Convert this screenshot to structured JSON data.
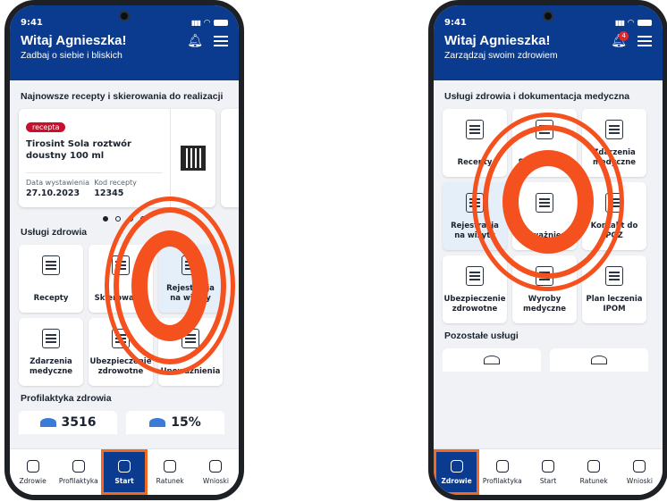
{
  "left_phone": {
    "time": "9:41",
    "greeting": "Witaj Agnieszka!",
    "subtitle": "Zadbaj o siebie i bliskich",
    "section_recent": "Najnowsze recepty i skierowania do realizacji",
    "prescription": {
      "badge": "recepta",
      "name": "Tirosint Sola roztwór doustny 100 ml",
      "date_label": "Data wystawienia",
      "date_value": "27.10.2023",
      "code_label": "Kod recepty",
      "code_value": "12345"
    },
    "section_services": "Usługi zdrowia",
    "tiles": [
      {
        "label": "Recepty",
        "icon": "prescription-icon"
      },
      {
        "label": "Skierowania",
        "icon": "referral-icon"
      },
      {
        "label": "Rejestracja na wizyty",
        "icon": "calendar-icon"
      },
      {
        "label": "Zdarzenia medyczne",
        "icon": "medical-events-icon"
      },
      {
        "label": "Ubezpieczenie zdrowotne",
        "icon": "insurance-icon"
      },
      {
        "label": "Upoważnienia",
        "icon": "authorization-icon"
      }
    ],
    "section_prevention": "Profilaktyka zdrowia",
    "prevention_stats": [
      "3516",
      "15%"
    ],
    "nav": [
      {
        "label": "Zdrowie",
        "icon": "health-icon"
      },
      {
        "label": "Profilaktyka",
        "icon": "shield-icon"
      },
      {
        "label": "Start",
        "icon": "home-icon"
      },
      {
        "label": "Ratunek",
        "icon": "heartbeat-icon"
      },
      {
        "label": "Wnioski",
        "icon": "mail-icon"
      }
    ]
  },
  "right_phone": {
    "time": "9:41",
    "greeting": "Witaj Agnieszka!",
    "subtitle": "Zarządzaj swoim zdrowiem",
    "notification_count": "4",
    "section_services": "Usługi zdrowia i dokumentacja medyczna",
    "tiles": [
      {
        "label": "Recepty",
        "icon": "prescription-icon"
      },
      {
        "label": "Skierowania",
        "icon": "referral-icon"
      },
      {
        "label": "Zdarzenia medyczne",
        "icon": "medical-events-icon"
      },
      {
        "label": "Rejestracja na wizyty",
        "icon": "calendar-icon"
      },
      {
        "label": "Upoważnienia",
        "icon": "authorization-icon"
      },
      {
        "label": "Kontakt do POZ",
        "icon": "contact-icon"
      },
      {
        "label": "Ubezpieczenie zdrowotne",
        "icon": "insurance-icon"
      },
      {
        "label": "Wyroby medyczne",
        "icon": "medical-devices-icon"
      },
      {
        "label": "Plan leczenia IPOM",
        "icon": "treatment-plan-icon"
      }
    ],
    "section_other": "Pozostałe usługi",
    "nav": [
      {
        "label": "Zdrowie",
        "icon": "health-icon"
      },
      {
        "label": "Profilaktyka",
        "icon": "shield-icon"
      },
      {
        "label": "Start",
        "icon": "home-icon"
      },
      {
        "label": "Ratunek",
        "icon": "heartbeat-icon"
      },
      {
        "label": "Wnioski",
        "icon": "mail-icon"
      }
    ]
  },
  "colors": {
    "header_blue": "#0b3b8f",
    "accent_orange": "#f4511e",
    "badge_red": "#c8102e"
  }
}
